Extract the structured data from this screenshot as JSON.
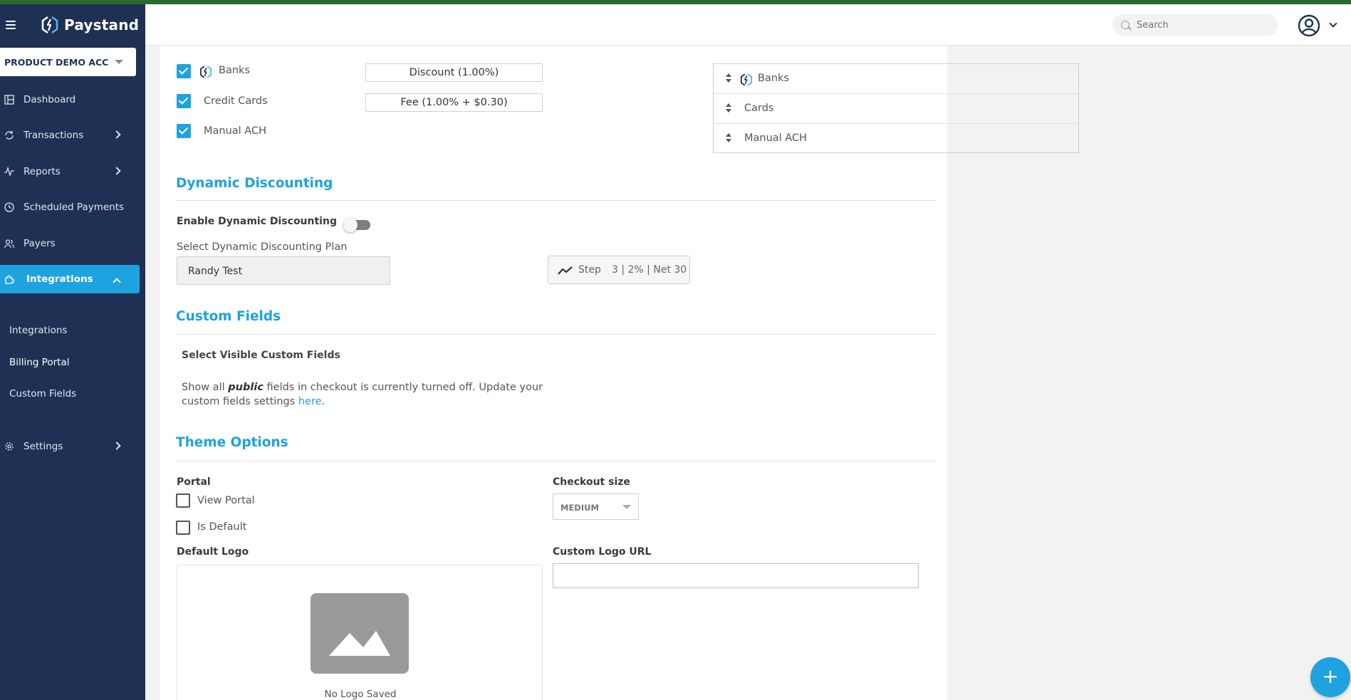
{
  "app": {
    "brand": "Paystand",
    "account": "PRODUCT DEMO ACC"
  },
  "sidebar": {
    "items": [
      {
        "label": "Dashboard",
        "icon": "dashboard-icon"
      },
      {
        "label": "Transactions",
        "icon": "sync-icon"
      },
      {
        "label": "Reports",
        "icon": "pulse-icon"
      },
      {
        "label": "Scheduled Payments",
        "icon": "clock-icon"
      },
      {
        "label": "Payers",
        "icon": "people-icon"
      },
      {
        "label": "Integrations",
        "icon": "puzzle-icon",
        "active": true
      },
      {
        "label": "Settings",
        "icon": "gear-icon"
      }
    ],
    "subitems": [
      "Integrations",
      "Billing Portal",
      "Custom Fields"
    ]
  },
  "header": {
    "search_placeholder": "Search"
  },
  "payment_methods": {
    "rows": [
      {
        "label": "Banks",
        "checked": true,
        "pricing": "Discount (1.00%)"
      },
      {
        "label": "Credit Cards",
        "checked": true,
        "pricing": "Fee (1.00% + $0.30)"
      },
      {
        "label": "Manual ACH",
        "checked": true,
        "pricing": ""
      }
    ],
    "order": [
      "Banks",
      "Cards",
      "Manual ACH"
    ]
  },
  "dynamic_discounting": {
    "title": "Dynamic Discounting",
    "enable_label": "Enable Dynamic Discounting",
    "enabled": false,
    "plan_label": "Select Dynamic Discounting Plan",
    "plan_value": "Randy Test",
    "step_label": "Step",
    "step_detail": "3 | 2% | Net 30"
  },
  "custom_fields": {
    "title": "Custom Fields",
    "subtitle": "Select Visible Custom Fields",
    "text_before": "Show all ",
    "text_emph": "public",
    "text_after": " fields in checkout is currently turned off. Update your custom fields settings ",
    "link": "here",
    "text_end": "."
  },
  "theme": {
    "title": "Theme Options",
    "portal_label": "Portal",
    "view_portal": "View Portal",
    "is_default": "Is Default",
    "checkout_size_label": "Checkout size",
    "checkout_size_value": "MEDIUM",
    "default_logo_label": "Default Logo",
    "custom_logo_url_label": "Custom Logo URL",
    "custom_logo_url_value": "",
    "no_logo": "No Logo Saved"
  },
  "colors": {
    "sidebar": "#1e3155",
    "accent": "#1ea2e0",
    "top_stripe": "#2a6a2e"
  }
}
